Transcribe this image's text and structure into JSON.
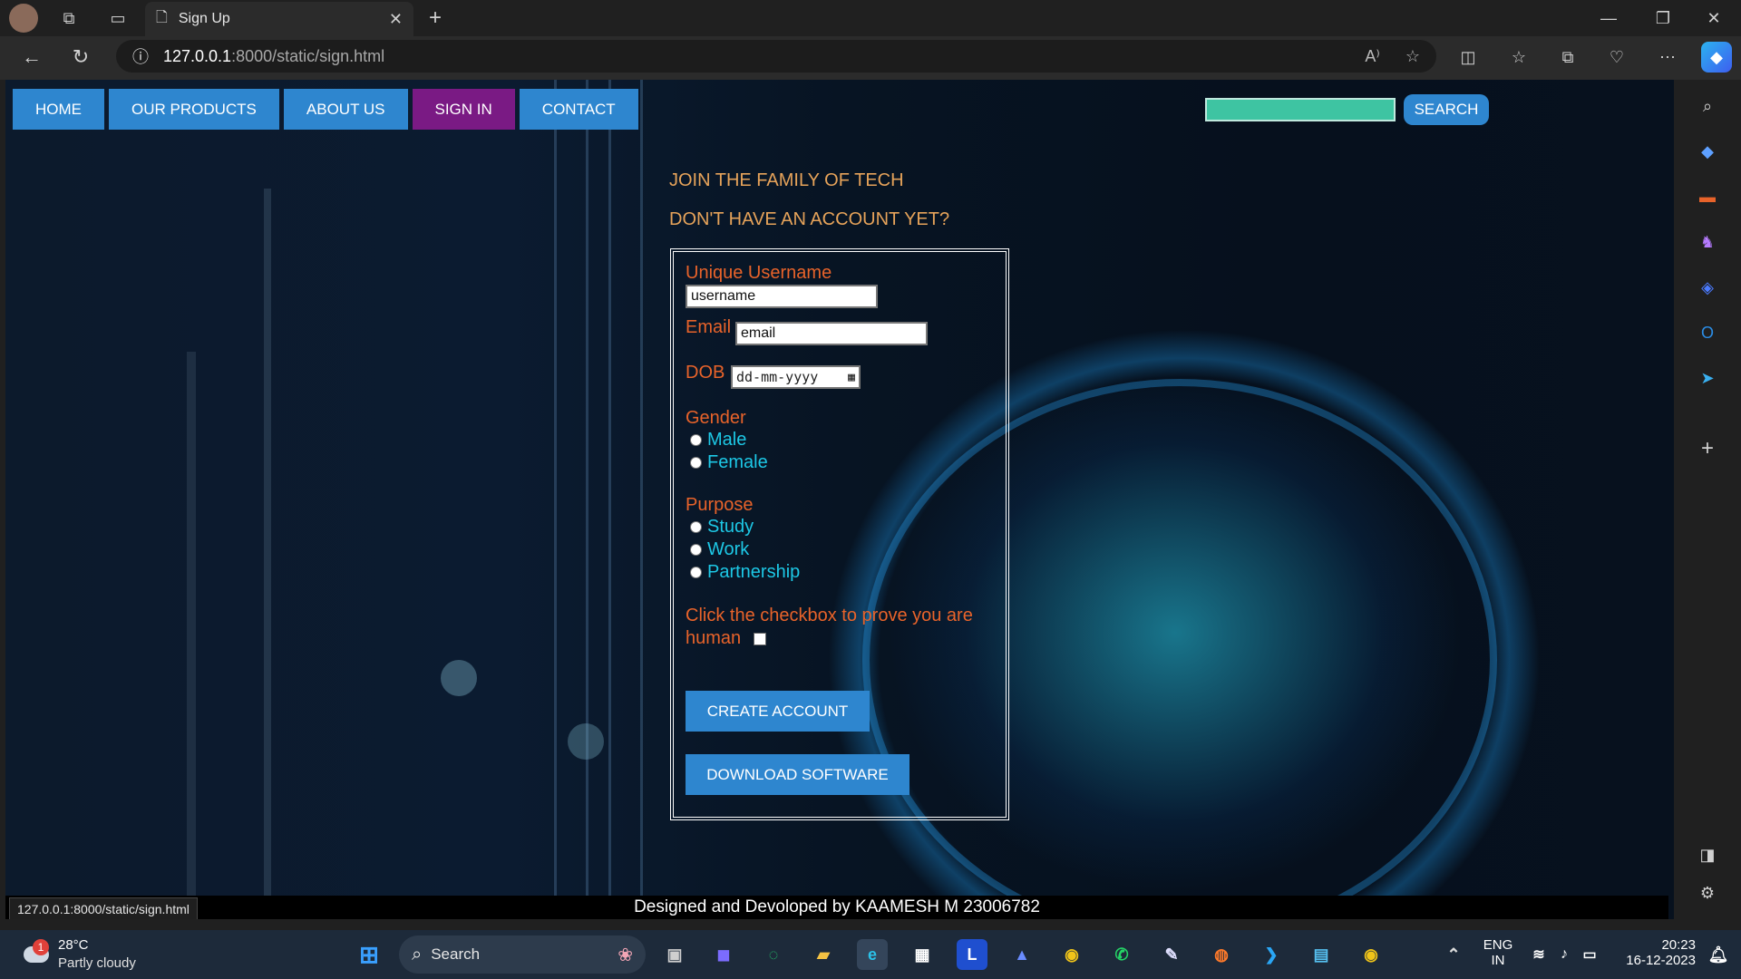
{
  "browser": {
    "tab_title": "Sign Up",
    "url_host": "127.0.0.1",
    "url_rest": ":8000/static/sign.html",
    "status_url": "127.0.0.1:8000/static/sign.html"
  },
  "nav": {
    "items": [
      {
        "label": "HOME"
      },
      {
        "label": "OUR PRODUCTS"
      },
      {
        "label": "ABOUT US"
      },
      {
        "label": "SIGN IN"
      },
      {
        "label": "CONTACT"
      }
    ],
    "active": "SIGN IN",
    "search_button": "SEARCH"
  },
  "headings": {
    "line1": "JOIN THE FAMILY OF TECH",
    "line2": "DON'T HAVE AN ACCOUNT YET?"
  },
  "form": {
    "username_label": "Unique Username",
    "username_placeholder": "username",
    "email_label": "Email",
    "email_placeholder": "email",
    "dob_label": "DOB",
    "dob_placeholder": "dd-mm-yyyy",
    "gender_label": "Gender",
    "gender_options": [
      "Male",
      "Female"
    ],
    "purpose_label": "Purpose",
    "purpose_options": [
      "Study",
      "Work",
      "Partnership"
    ],
    "human_check_line1": "Click the checkbox to prove you are",
    "human_check_line2": "human",
    "create_button": "CREATE ACCOUNT",
    "download_button": "DOWNLOAD SOFTWARE"
  },
  "footer": {
    "text": "Designed and Devoloped by KAAMESH M 23006782"
  },
  "taskbar": {
    "weather_temp": "28°C",
    "weather_desc": "Partly cloudy",
    "weather_badge": "1",
    "search_label": "Search",
    "lang_line1": "ENG",
    "lang_line2": "IN",
    "time": "20:23",
    "date": "16-12-2023"
  },
  "colors": {
    "nav_button": "#2e86cf",
    "nav_active": "#7a1a84",
    "label_orange": "#e8632a",
    "option_cyan": "#1dc8e6",
    "heading_gold": "#e6a35a"
  }
}
